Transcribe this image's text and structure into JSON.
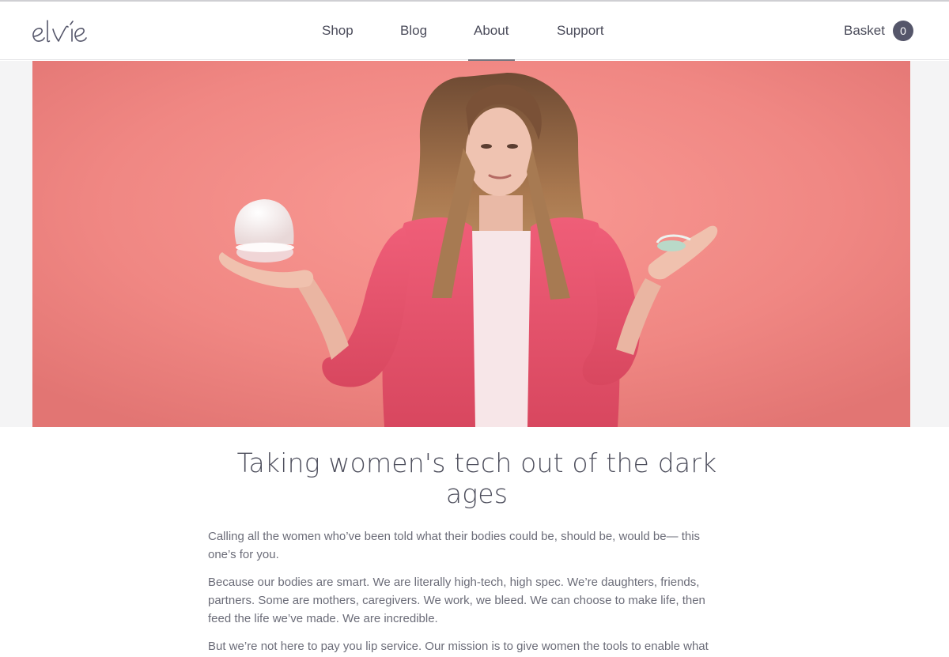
{
  "brand": {
    "logo_text": "elvie",
    "text_color": "#55566a"
  },
  "nav": {
    "items": [
      {
        "label": "Shop"
      },
      {
        "label": "Blog"
      },
      {
        "label": "About",
        "active": true
      },
      {
        "label": "Support"
      }
    ]
  },
  "basket": {
    "label": "Basket",
    "count": "0"
  },
  "hero": {
    "background_color": "#f28a86",
    "jacket_color": "#e2506b",
    "subject": "woman-holding-products"
  },
  "article": {
    "heading": "Taking women's tech out of the dark ages",
    "paragraphs": [
      "Calling all the women who’ve been told what their bodies could be, should be, would be— this one’s for you.",
      "Because our bodies are smart. We are literally high-tech, high spec. We’re daughters, friends, partners. Some are mothers, caregivers. We work, we bleed. We can choose to make life, then feed the life we’ve made. We are incredible.",
      "But we’re not here to pay you lip service. Our mission is to give women the tools to enable what their bodies have always been capable of, across every phase of womanhood."
    ]
  }
}
